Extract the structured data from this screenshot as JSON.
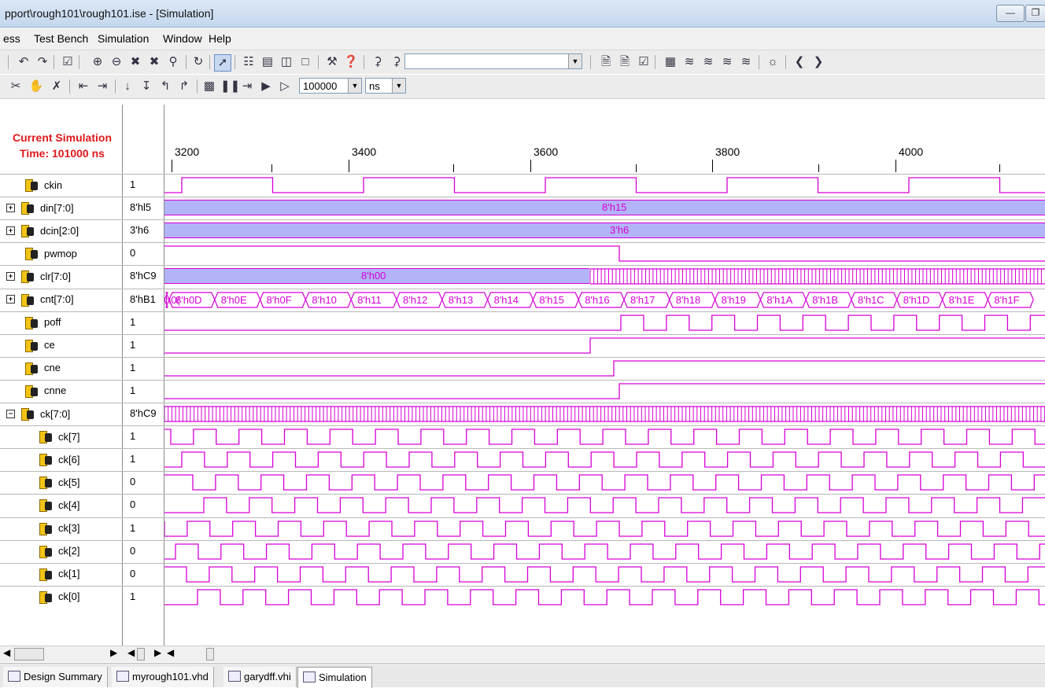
{
  "window": {
    "title": "pport\\rough101\\rough101.ise - [Simulation]"
  },
  "menu": [
    "ess",
    "Test Bench",
    "Simulation",
    "Window",
    "Help"
  ],
  "toolbar": {
    "search_value": "",
    "sim_time_value": "100000",
    "sim_time_unit": "ns"
  },
  "waveform": {
    "current_label_line1": "Current Simulation",
    "current_label_line2": "Time: 101000 ns",
    "time_ticks": [
      "3200",
      "3400",
      "3600",
      "3800",
      "4000"
    ],
    "signals": [
      {
        "name": "ckin",
        "value": "1",
        "kind": "bit",
        "expand": ""
      },
      {
        "name": "din[7:0]",
        "value": "8'hl5",
        "kind": "bus",
        "expand": "+",
        "bus_label": "8'h15"
      },
      {
        "name": "dcin[2:0]",
        "value": "3'h6",
        "kind": "bus",
        "expand": "+",
        "bus_label": "3'h6"
      },
      {
        "name": "pwmop",
        "value": "0",
        "kind": "bit",
        "expand": ""
      },
      {
        "name": "clr[7:0]",
        "value": "8'hC9",
        "kind": "bus",
        "expand": "+",
        "bus_label": "8'h00"
      },
      {
        "name": "cnt[7:0]",
        "value": "8'hB1",
        "kind": "bus",
        "expand": "+",
        "segments": [
          "h0(",
          "8'h0D",
          "8'h0E",
          "8'h0F",
          "8'h10",
          "8'h11",
          "8'h12",
          "8'h13",
          "8'h14",
          "8'h15",
          "8'h16",
          "8'h17",
          "8'h18",
          "8'h19",
          "8'h1A",
          "8'h1B",
          "8'h1C",
          "8'h1D",
          "8'h1E",
          "8'h1F"
        ]
      },
      {
        "name": "poff",
        "value": "1",
        "kind": "bit",
        "expand": ""
      },
      {
        "name": "ce",
        "value": "1",
        "kind": "bit",
        "expand": ""
      },
      {
        "name": "cne",
        "value": "1",
        "kind": "bit",
        "expand": ""
      },
      {
        "name": "cnne",
        "value": "1",
        "kind": "bit",
        "expand": ""
      },
      {
        "name": "ck[7:0]",
        "value": "8'hC9",
        "kind": "bus",
        "expand": "-"
      },
      {
        "name": "ck[7]",
        "value": "1",
        "kind": "bit",
        "expand": "",
        "indent": true
      },
      {
        "name": "ck[6]",
        "value": "1",
        "kind": "bit",
        "expand": "",
        "indent": true
      },
      {
        "name": "ck[5]",
        "value": "0",
        "kind": "bit",
        "expand": "",
        "indent": true
      },
      {
        "name": "ck[4]",
        "value": "0",
        "kind": "bit",
        "expand": "",
        "indent": true
      },
      {
        "name": "ck[3]",
        "value": "1",
        "kind": "bit",
        "expand": "",
        "indent": true
      },
      {
        "name": "ck[2]",
        "value": "0",
        "kind": "bit",
        "expand": "",
        "indent": true
      },
      {
        "name": "ck[1]",
        "value": "0",
        "kind": "bit",
        "expand": "",
        "indent": true
      },
      {
        "name": "ck[0]",
        "value": "1",
        "kind": "bit",
        "expand": "",
        "indent": true
      }
    ]
  },
  "tabs": [
    "Design Summary",
    "myrough101.vhd",
    "garydff.vhi",
    "Simulation"
  ],
  "colors": {
    "wave": "#d600d6",
    "bus_fill": "#b3b3f8",
    "time_label": "#e0191b"
  }
}
